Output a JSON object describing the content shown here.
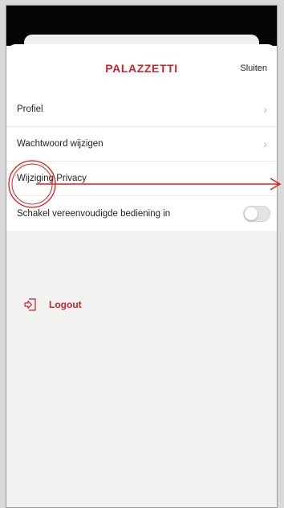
{
  "header": {
    "logo_text": "PALAZZETTI",
    "close_label": "Sluiten"
  },
  "menu": {
    "items": [
      {
        "label": "Profiel"
      },
      {
        "label": "Wachtwoord wijzigen"
      },
      {
        "label": "Wijziging Privacy"
      },
      {
        "label": "Schakel vereenvoudigde bediening in",
        "toggle_on": false
      }
    ]
  },
  "logout": {
    "label": "Logout"
  },
  "colors": {
    "brand": "#c4262e",
    "annotation": "#e01b1b"
  },
  "icons": {
    "chevron": "chevron-right-icon",
    "logout": "logout-icon"
  }
}
